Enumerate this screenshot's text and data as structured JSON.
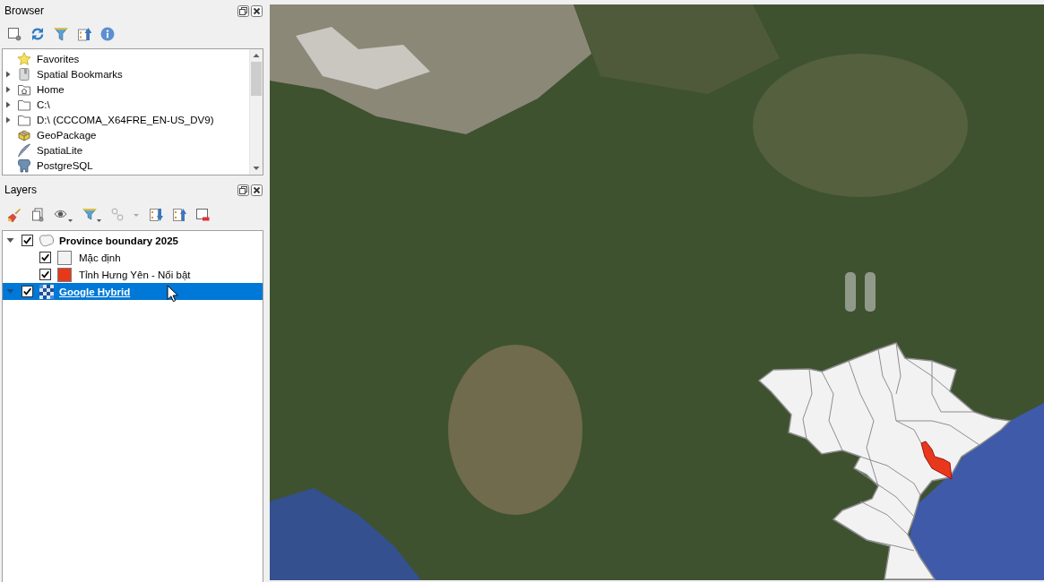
{
  "browser": {
    "title": "Browser",
    "toolbar": [
      {
        "kind": "add",
        "disabled": false
      },
      {
        "kind": "refresh",
        "disabled": false
      },
      {
        "kind": "filter",
        "disabled": false
      },
      {
        "kind": "collapse",
        "disabled": false
      },
      {
        "kind": "properties",
        "disabled": false
      }
    ],
    "items": [
      {
        "label": "Favorites",
        "kind": "favorites"
      },
      {
        "label": "Spatial Bookmarks",
        "kind": "bookmarks",
        "expanded": false
      },
      {
        "label": "Home",
        "kind": "home",
        "expanded": false
      },
      {
        "label": "C:\\",
        "kind": "drive",
        "expanded": false
      },
      {
        "label": "D:\\ (CCCOMA_X64FRE_EN-US_DV9)",
        "kind": "drive",
        "expanded": false
      },
      {
        "label": "GeoPackage",
        "kind": "geopackage"
      },
      {
        "label": "SpatiaLite",
        "kind": "spatialite"
      },
      {
        "label": "PostgreSQL",
        "kind": "postgresql"
      }
    ]
  },
  "layers_panel": {
    "title": "Layers",
    "toolbar": [
      {
        "kind": "style",
        "disabled": false
      },
      {
        "kind": "add_group",
        "disabled": false
      },
      {
        "kind": "visibility",
        "disabled": false
      },
      {
        "kind": "filter",
        "disabled": false
      },
      {
        "kind": "expression",
        "disabled": true
      },
      {
        "kind": "expand_all",
        "disabled": false
      },
      {
        "kind": "collapse_all",
        "disabled": false
      },
      {
        "kind": "remove",
        "disabled": false
      }
    ],
    "tree": [
      {
        "label": "Province boundary 2025",
        "kind": "vector",
        "expanded": true,
        "checked": true,
        "selected": false,
        "underlined": false,
        "children": [
          {
            "label": "Mặc định",
            "kind": "symbol",
            "color": "#f2f2f2",
            "checked": true,
            "selected": false,
            "underlined": false
          },
          {
            "label": "Tỉnh Hưng Yên - Nổi bật",
            "kind": "symbol",
            "color": "#e8381c",
            "checked": true,
            "selected": false,
            "underlined": false
          }
        ]
      },
      {
        "label": "Google Hybrid",
        "kind": "raster",
        "expanded": true,
        "checked": true,
        "selected": true,
        "underlined": true
      }
    ]
  }
}
